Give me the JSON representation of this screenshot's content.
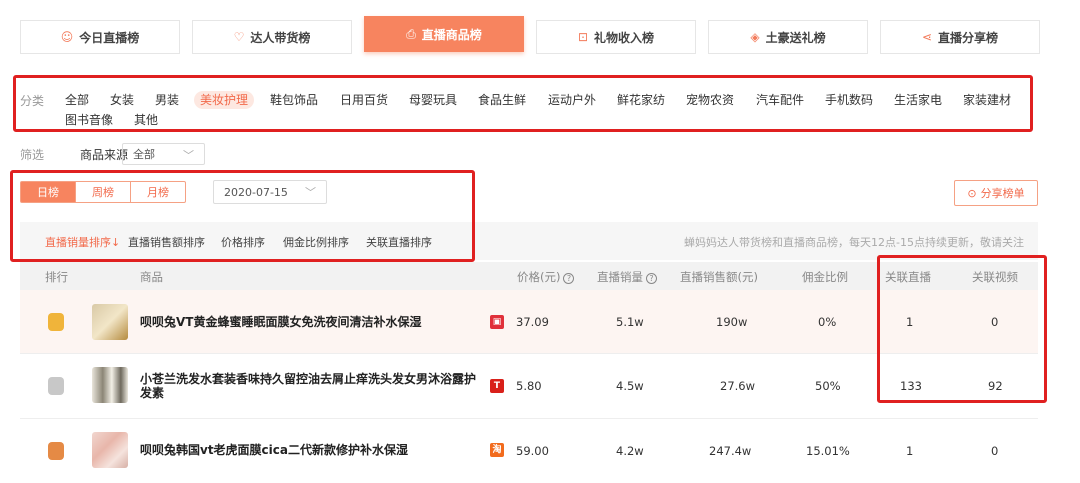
{
  "top_tabs": [
    {
      "label": "今日直播榜",
      "icon": "smile-circle-icon"
    },
    {
      "label": "达人带货榜",
      "icon": "heart-badge-icon"
    },
    {
      "label": "直播商品榜",
      "icon": "bag-icon"
    },
    {
      "label": "礼物收入榜",
      "icon": "gift-icon"
    },
    {
      "label": "土豪送礼榜",
      "icon": "diamond-icon"
    },
    {
      "label": "直播分享榜",
      "icon": "share-icon"
    }
  ],
  "category": {
    "label": "分类",
    "items": [
      "全部",
      "女装",
      "男装",
      "美妆护理",
      "鞋包饰品",
      "日用百货",
      "母婴玩具",
      "食品生鲜",
      "运动户外",
      "鲜花家纺",
      "宠物农资",
      "汽车配件",
      "手机数码",
      "生活家电",
      "家装建材",
      "图书音像",
      "其他"
    ],
    "active": "美妆护理"
  },
  "filter": {
    "label": "筛选",
    "source_label": "商品来源",
    "source_value": "全部"
  },
  "period": {
    "tabs": [
      "日榜",
      "周榜",
      "月榜"
    ],
    "active": "日榜",
    "date": "2020-07-15"
  },
  "share_button": "分享榜单",
  "sort": {
    "items": [
      "直播销量排序",
      "直播销售额排序",
      "价格排序",
      "佣金比例排序",
      "关联直播排序"
    ],
    "active": "直播销量排序",
    "note": "蝉妈妈达人带货榜和直播商品榜，每天12点-15点持续更新，敬请关注"
  },
  "table": {
    "headers": [
      "排行",
      "商品",
      "价格(元)",
      "直播销量",
      "直播销售额(元)",
      "佣金比例",
      "关联直播",
      "关联视频"
    ],
    "rows": [
      {
        "name": "呗呗兔VT黄金蜂蜜睡眠面膜女免洗夜间清洁补水保湿",
        "platform": "shop",
        "price": "37.09",
        "sales": "5.1w",
        "revenue": "190w",
        "commission": "0%",
        "live": "1",
        "video": "0"
      },
      {
        "name": "小苍兰洗发水套装香味持久留控油去屑止痒洗头发女男沐浴露护发素",
        "platform": "tmall",
        "price": "5.80",
        "sales": "4.5w",
        "revenue": "27.6w",
        "commission": "50%",
        "live": "133",
        "video": "92"
      },
      {
        "name": "呗呗兔韩国vt老虎面膜cica二代新款修护补水保湿",
        "platform": "taobao",
        "price": "59.00",
        "sales": "4.2w",
        "revenue": "247.4w",
        "commission": "15.01%",
        "live": "1",
        "video": "0"
      }
    ]
  },
  "colors": {
    "accent": "#f7845f",
    "annotation_red": "#e02020",
    "gold": "#f0b43a",
    "silver": "#c8c8c8",
    "bronze": "#e58a45"
  }
}
